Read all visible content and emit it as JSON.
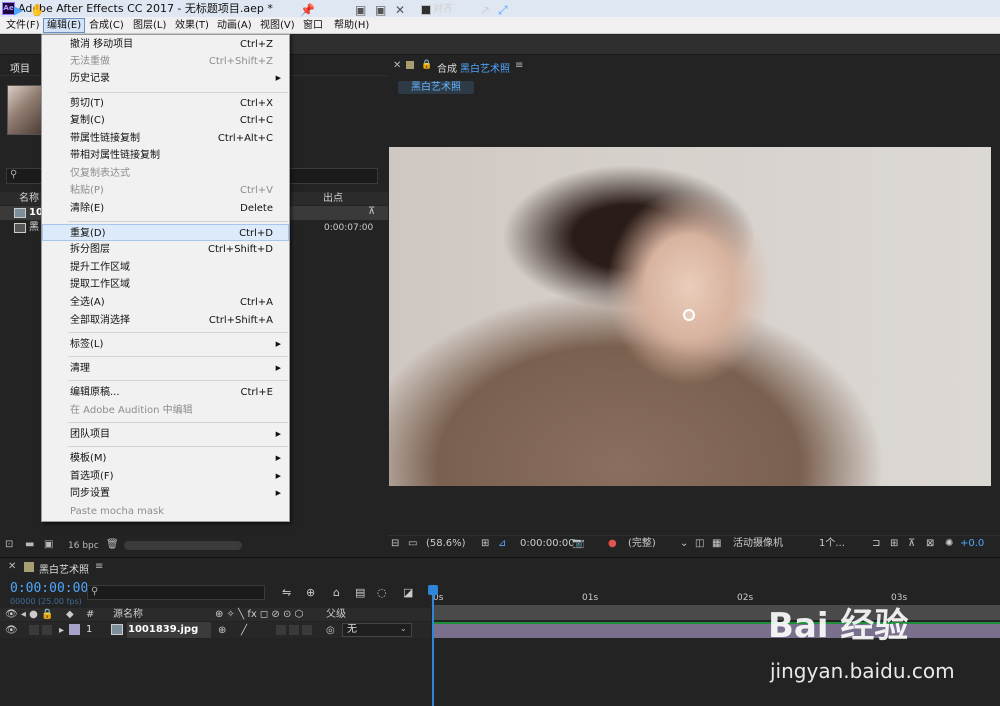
{
  "window": {
    "title": "Adobe After Effects CC 2017 - 无标题项目.aep *"
  },
  "menubar": {
    "items": [
      "文件(F)",
      "编辑(E)",
      "合成(C)",
      "图层(L)",
      "效果(T)",
      "动画(A)",
      "视图(V)",
      "窗口",
      "帮助(H)"
    ]
  },
  "toolbar": {
    "snap_label": "对齐"
  },
  "edit_menu": {
    "items": [
      {
        "label": "撤消 移动项目",
        "shortcut": "Ctrl+Z"
      },
      {
        "label": "无法重做",
        "shortcut": "Ctrl+Shift+Z"
      },
      {
        "label": "历史记录",
        "shortcut": ""
      },
      {
        "label": "剪切(T)",
        "shortcut": "Ctrl+X"
      },
      {
        "label": "复制(C)",
        "shortcut": "Ctrl+C"
      },
      {
        "label": "带属性链接复制",
        "shortcut": "Ctrl+Alt+C"
      },
      {
        "label": "带相对属性链接复制",
        "shortcut": ""
      },
      {
        "label": "仅复制表达式",
        "shortcut": ""
      },
      {
        "label": "粘贴(P)",
        "shortcut": "Ctrl+V"
      },
      {
        "label": "清除(E)",
        "shortcut": "Delete"
      },
      {
        "label": "重复(D)",
        "shortcut": "Ctrl+D"
      },
      {
        "label": "拆分图层",
        "shortcut": "Ctrl+Shift+D"
      },
      {
        "label": "提升工作区域",
        "shortcut": ""
      },
      {
        "label": "提取工作区域",
        "shortcut": ""
      },
      {
        "label": "全选(A)",
        "shortcut": "Ctrl+A"
      },
      {
        "label": "全部取消选择",
        "shortcut": "Ctrl+Shift+A"
      },
      {
        "label": "标签(L)",
        "shortcut": ""
      },
      {
        "label": "清理",
        "shortcut": ""
      },
      {
        "label": "编辑原稿...",
        "shortcut": "Ctrl+E"
      },
      {
        "label": "在 Adobe Audition 中编辑",
        "shortcut": ""
      },
      {
        "label": "团队项目",
        "shortcut": ""
      },
      {
        "label": "模板(M)",
        "shortcut": ""
      },
      {
        "label": "首选项(F)",
        "shortcut": ""
      },
      {
        "label": "同步设置",
        "shortcut": ""
      },
      {
        "label": "Paste mocha mask",
        "shortcut": ""
      }
    ]
  },
  "project_panel": {
    "tab_label": "项目",
    "columns": {
      "name": "名称",
      "out_point": "出点"
    },
    "rows": [
      {
        "name": "100",
        "out": ""
      },
      {
        "name": "黑",
        "out": "0:00:07:00"
      }
    ],
    "bit_depth": "16 bpc"
  },
  "comp_panel": {
    "label": "合成",
    "tab_name": "黑白艺术照",
    "sub_tab": "黑白艺术照",
    "controls": {
      "zoom": "(58.6%)",
      "time": "0:00:00:00",
      "resolution": "(完整)",
      "camera": "活动摄像机",
      "views": "1个...",
      "exposure": "+0.0"
    }
  },
  "timeline": {
    "comp_name": "黑白艺术照",
    "timecode": "0:00:00:00",
    "frames": "00000 (25.00 fps)",
    "columns": {
      "source_name": "源名称",
      "parent": "父级"
    },
    "layer": {
      "number": "1",
      "name": "1001839.jpg",
      "parent": "无"
    },
    "ruler": [
      "0s",
      "01s",
      "02s",
      "03s"
    ]
  },
  "watermark": {
    "brand": "Bai 经验",
    "url": "jingyan.baidu.com"
  }
}
